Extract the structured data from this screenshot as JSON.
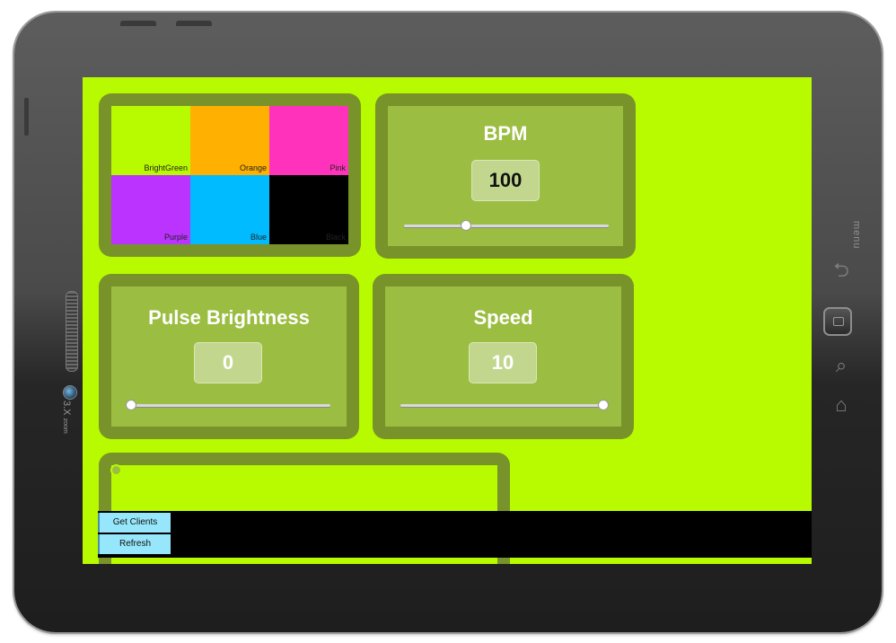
{
  "device": {
    "zoom_label_main": "3.X",
    "zoom_label_sub": "zoom",
    "menu_label": "menu"
  },
  "colors": {
    "screen_bg": "#b8fb00",
    "panel_outer": "#77932a",
    "panel_inner": "#9bbd41"
  },
  "color_picker": {
    "swatches": [
      {
        "label": "BrightGreen",
        "color": "#b8fb00"
      },
      {
        "label": "Orange",
        "color": "#ffb000"
      },
      {
        "label": "Pink",
        "color": "#ff33bb"
      },
      {
        "label": "Purple",
        "color": "#bb33ff"
      },
      {
        "label": "Blue",
        "color": "#00bbff"
      },
      {
        "label": "Black",
        "color": "#000000"
      }
    ]
  },
  "bpm": {
    "title": "BPM",
    "value": "100",
    "slider_fraction": 0.3
  },
  "pulse_brightness": {
    "title": "Pulse Brightness",
    "value": "0",
    "slider_fraction": 0.0
  },
  "speed": {
    "title": "Speed",
    "value": "10",
    "slider_fraction": 1.0
  },
  "bottom_bar": {
    "get_clients_label": "Get Clients",
    "refresh_label": "Refresh"
  }
}
